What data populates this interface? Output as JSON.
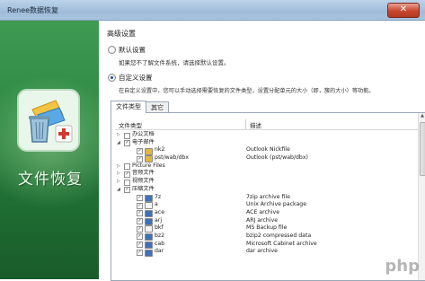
{
  "window": {
    "title": "Renee数据恢复",
    "close_icon": "close-icon"
  },
  "sidepanel": {
    "title": "文件恢复",
    "logo_icon": "recycle-bin-recovery-icon"
  },
  "settings": {
    "section_title": "高级设置",
    "default_option": {
      "label": "默认设置",
      "hint": "如果您不了解文件系统，请选择默认设置。",
      "selected": false
    },
    "custom_option": {
      "label": "自定义设置",
      "hint": "在自定义设置中，您可以手动选择需要恢复的文件类型，设置分配单元的大小（即，簇的大小）等功能。",
      "selected": true
    }
  },
  "tabs": [
    {
      "label": "文件类型",
      "active": true
    },
    {
      "label": "其它",
      "active": false
    }
  ],
  "table": {
    "columns": [
      "文件类型",
      "描述"
    ],
    "rows": [
      {
        "level": 0,
        "expander": "▷",
        "checked": false,
        "icon": "",
        "name": "办公文档",
        "desc": ""
      },
      {
        "level": 0,
        "expander": "◢",
        "checked": true,
        "icon": "",
        "name": "电子邮件",
        "desc": ""
      },
      {
        "level": 1,
        "expander": "",
        "checked": true,
        "icon": "mail-file-icon",
        "name": "nk2",
        "desc": "Outlook Nickfile"
      },
      {
        "level": 1,
        "expander": "",
        "checked": true,
        "icon": "mail-file-icon",
        "name": "pst/wab/dbx",
        "desc": "Outlook (pst/wab/dbx)"
      },
      {
        "level": 0,
        "expander": "▷",
        "checked": false,
        "icon": "",
        "name": "Picture Files",
        "desc": ""
      },
      {
        "level": 0,
        "expander": "▷",
        "checked": true,
        "icon": "",
        "name": "音频文件",
        "desc": ""
      },
      {
        "level": 0,
        "expander": "▷",
        "checked": false,
        "icon": "",
        "name": "视频文件",
        "desc": ""
      },
      {
        "level": 0,
        "expander": "◢",
        "checked": true,
        "icon": "",
        "name": "压缩文件",
        "desc": ""
      },
      {
        "level": 1,
        "expander": "",
        "checked": true,
        "icon": "archive-file-icon",
        "name": "7z",
        "desc": "7zip archive file"
      },
      {
        "level": 1,
        "expander": "",
        "checked": true,
        "icon": "blank-file-icon",
        "name": "a",
        "desc": "Unix Archive package"
      },
      {
        "level": 1,
        "expander": "",
        "checked": true,
        "icon": "archive-file-icon",
        "name": "ace",
        "desc": "ACE archive"
      },
      {
        "level": 1,
        "expander": "",
        "checked": true,
        "icon": "archive-file-icon",
        "name": "arj",
        "desc": "ARJ archive"
      },
      {
        "level": 1,
        "expander": "",
        "checked": true,
        "icon": "blank-file-icon",
        "name": "bkf",
        "desc": "MS Backup file"
      },
      {
        "level": 1,
        "expander": "",
        "checked": true,
        "icon": "archive-file-icon",
        "name": "bz2",
        "desc": "bzip2 compressed data"
      },
      {
        "level": 1,
        "expander": "",
        "checked": true,
        "icon": "archive-file-icon",
        "name": "cab",
        "desc": "Microsoft Cabinet archive"
      },
      {
        "level": 1,
        "expander": "",
        "checked": true,
        "icon": "archive-file-icon",
        "name": "dar",
        "desc": "dar archive"
      }
    ]
  },
  "watermark": "php",
  "colors": {
    "side_green": "#2f8a44",
    "accent_blue": "#1f4f8a",
    "close_red": "#c8462f"
  }
}
